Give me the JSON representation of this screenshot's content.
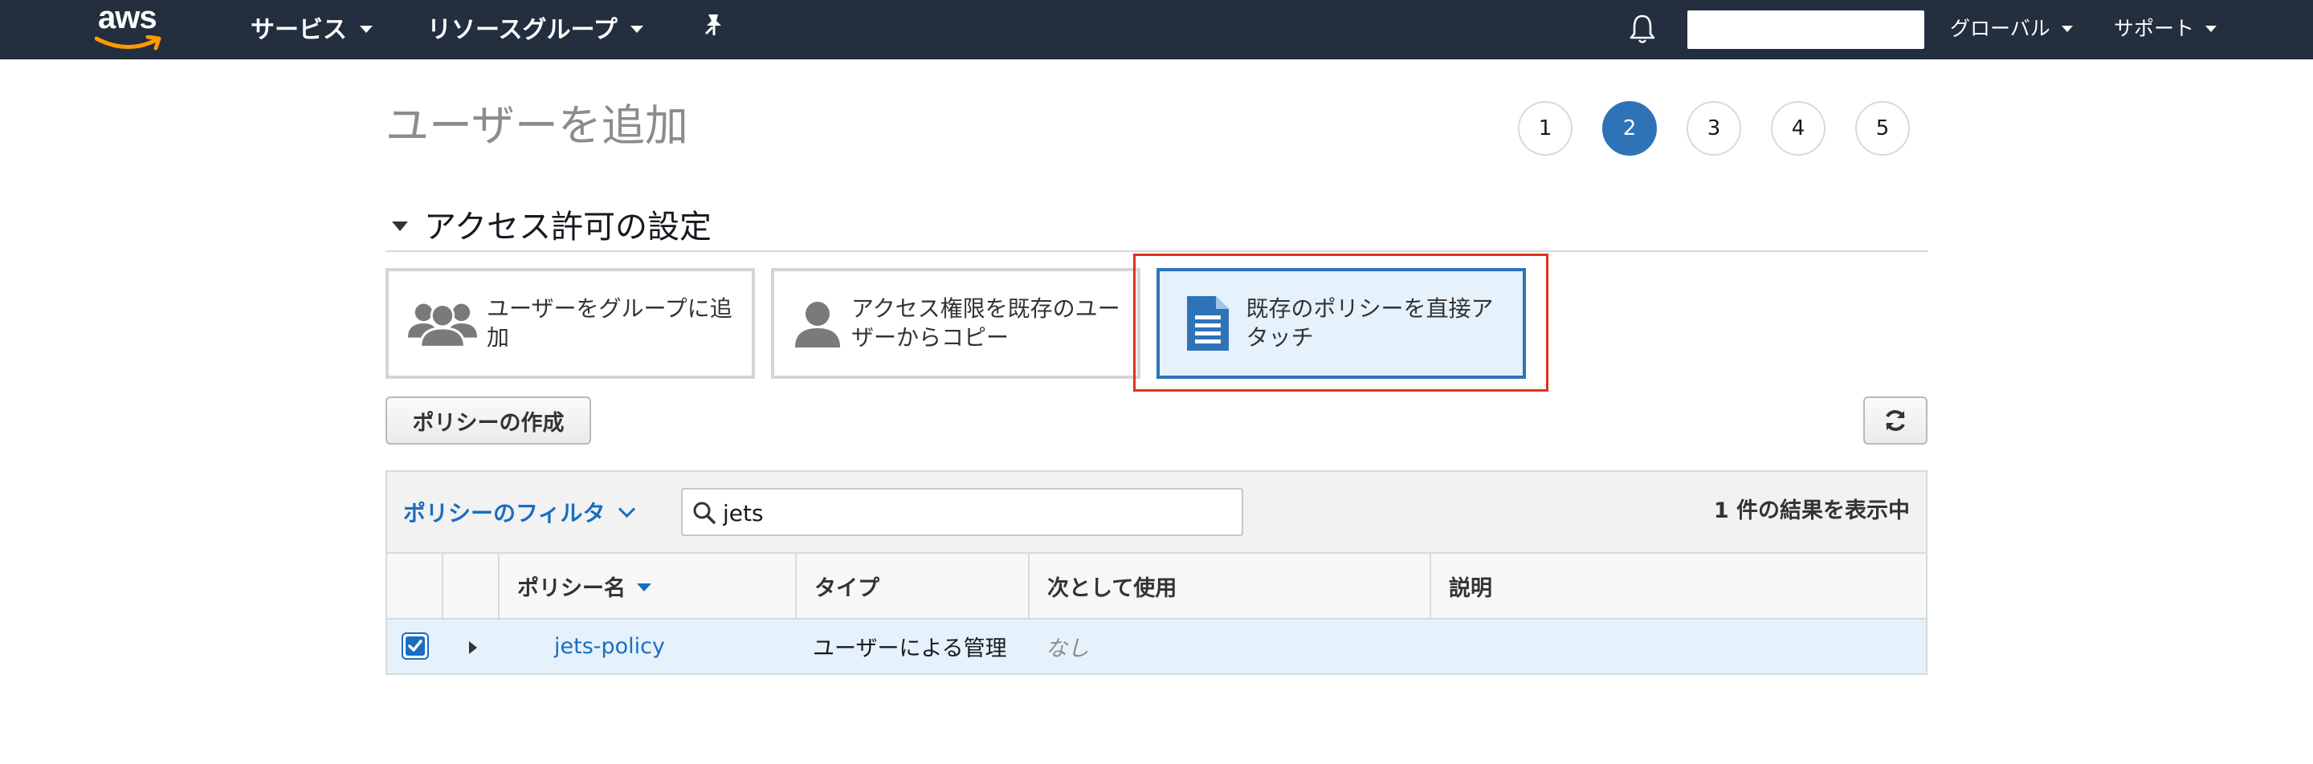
{
  "nav": {
    "logo_text": "aws",
    "services": "サービス",
    "resource_groups": "リソースグループ",
    "account": "",
    "region": "グローバル",
    "support": "サポート"
  },
  "page": {
    "title": "ユーザーを追加",
    "steps": [
      "1",
      "2",
      "3",
      "4",
      "5"
    ],
    "active_step": "2"
  },
  "permissions": {
    "section_title": "アクセス許可の設定",
    "options": [
      {
        "label": "ユーザーをグループに追加",
        "icon": "user-group-icon"
      },
      {
        "label": "アクセス権限を既存のユーザーからコピー",
        "icon": "user-icon"
      },
      {
        "label": "既存のポリシーを直接アタッチ",
        "icon": "document-icon",
        "selected": true
      }
    ],
    "create_policy": "ポリシーの作成"
  },
  "table": {
    "filter_label": "ポリシーのフィルタ",
    "search_value": "jets",
    "result_count": "1 件の結果を表示中",
    "columns": [
      "ポリシー名",
      "タイプ",
      "次として使用",
      "説明"
    ],
    "rows": [
      {
        "name": "jets-policy",
        "type": "ユーザーによる管理",
        "used_as": "なし",
        "description": "",
        "checked": true
      }
    ]
  },
  "colors": {
    "nav_bg": "#232f3e",
    "accent": "#2e73b8",
    "link": "#1a6ec1",
    "highlight_box": "#e0311c",
    "selected_bg": "#e5f1fb"
  }
}
